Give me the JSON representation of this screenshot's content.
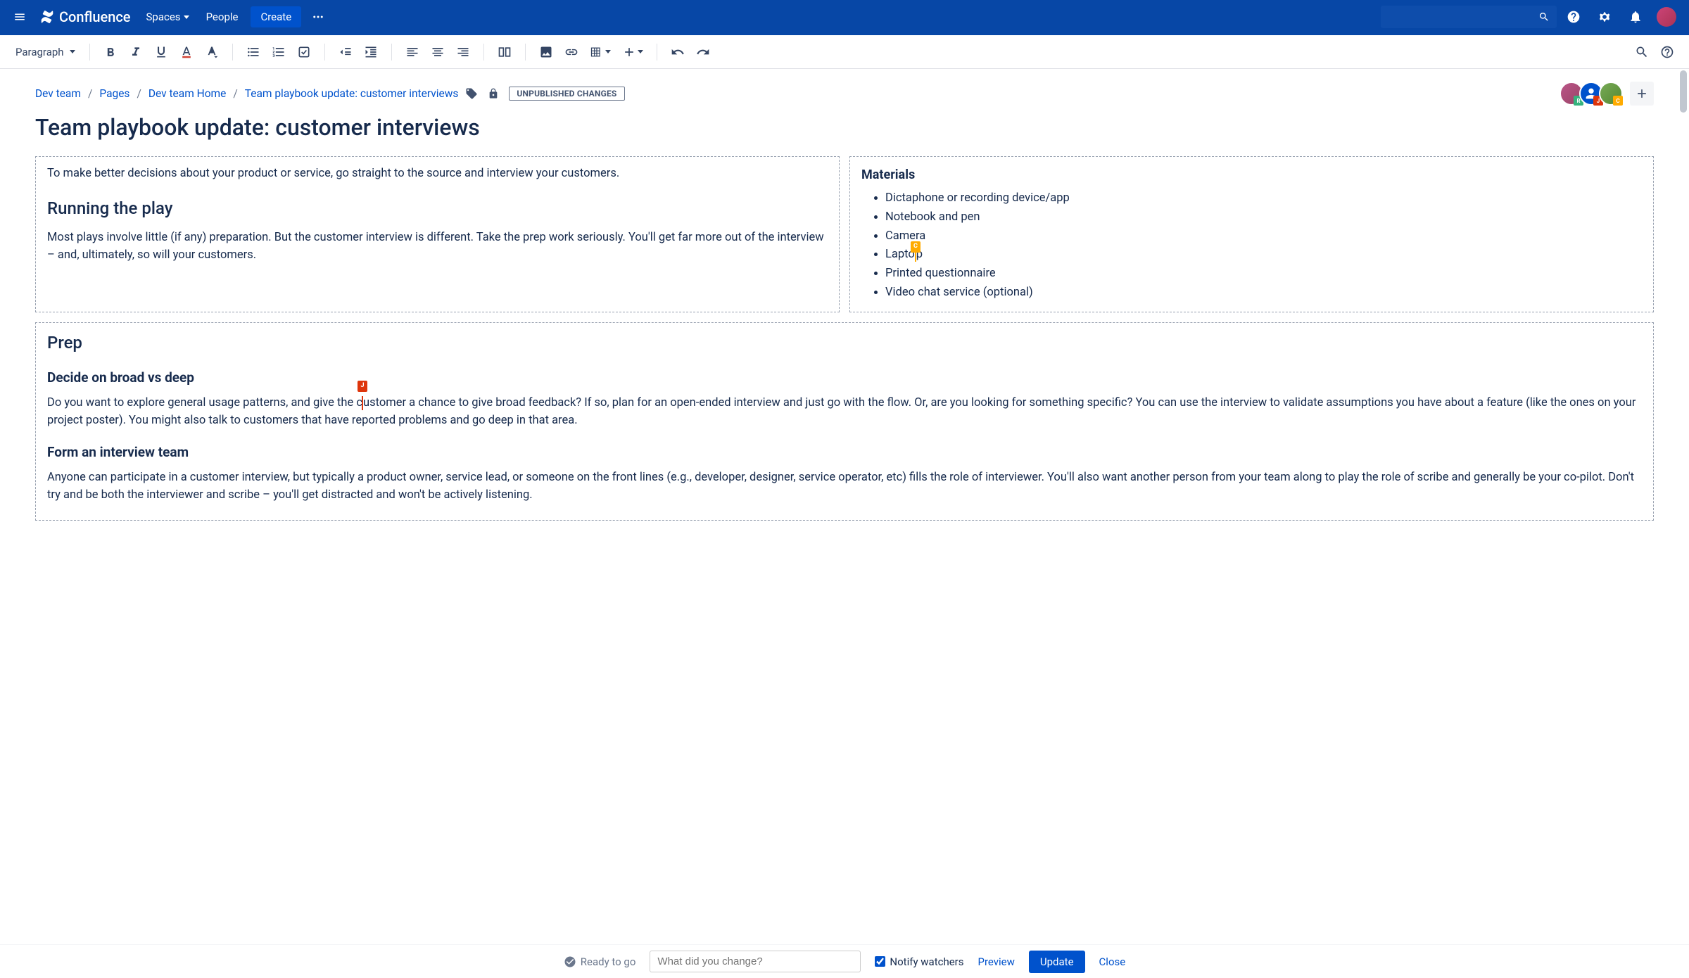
{
  "nav": {
    "logo": "Confluence",
    "spaces": "Spaces",
    "people": "People",
    "create": "Create"
  },
  "toolbar": {
    "style": "Paragraph"
  },
  "breadcrumb": {
    "a": "Dev team",
    "b": "Pages",
    "c": "Dev team Home",
    "d": "Team playbook update: customer interviews"
  },
  "badge": "UNPUBLISHED CHANGES",
  "collab_badges": {
    "r": "R",
    "j": "J",
    "c": "C"
  },
  "title": "Team playbook update: customer interviews",
  "intro": "To make better decisions about your product or service, go straight to the source and interview your customers.",
  "running_h": "Running the play",
  "running_p": "Most plays involve little (if any) preparation. But the customer interview is different. Take the prep work seriously. You'll get far more out of the interview – and, ultimately, so will your customers.",
  "materials_h": "Materials",
  "materials": {
    "m0": "Dictaphone or recording device/app",
    "m1": "Notebook and pen",
    "m2_a": "Came",
    "m2_b": "ra",
    "m3_a": "Lapto",
    "m3_b": "p",
    "m4": "Printed questionnaire",
    "m5": "Video chat service (optional)"
  },
  "cursor_c": "C",
  "prep_h": "Prep",
  "decide_h": "Decide on broad vs deep",
  "cursor_j": "J",
  "decide_p_a": "Do you want to explore general usage patterns, and give the c",
  "decide_p_b": "ustomer a chance to give broad feedback? If so, plan for an open-ended interview and just go with the flow. Or, are you looking for something specific? You can use the interview to validate assumptions you have about a feature (like the ones on your project poster). You might also talk to customers that have reported problems and go deep in that area.",
  "form_h": "Form an interview team",
  "form_p": "Anyone can participate in a customer interview, but typically a product owner, service lead, or someone on the front lines (e.g., developer, designer, service operator, etc) fills the role of interviewer. You'll also want another person from your team along to play the role of scribe and generally be your co-pilot. Don't try and be both the interviewer and scribe – you'll get distracted and won't be actively listening.",
  "footer": {
    "status": "Ready to go",
    "placeholder": "What did you change?",
    "notify": "Notify watchers",
    "preview": "Preview",
    "update": "Update",
    "close": "Close"
  }
}
